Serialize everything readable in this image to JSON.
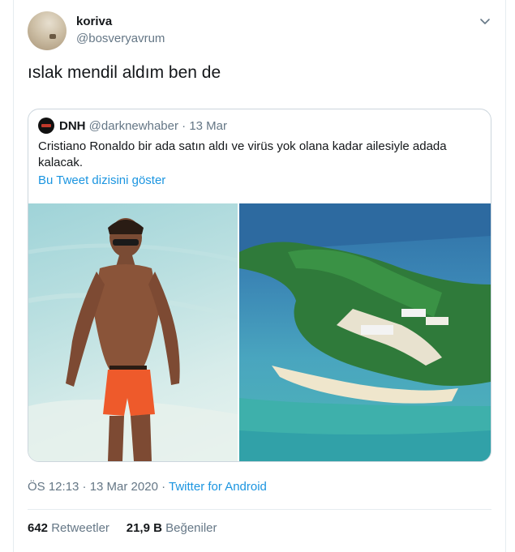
{
  "tweet": {
    "user_name": "koriva",
    "user_handle": "@bosveryavrum",
    "text": "ıslak mendil aldım ben de",
    "timestamp": "ÖS 12:13 · 13 Mar 2020",
    "source_sep": "·",
    "source": "Twitter for Android",
    "retweets_count": "642",
    "retweets_label": "Retweetler",
    "likes_count": "21,9 B",
    "likes_label": "Beğeniler"
  },
  "quote": {
    "name": "DNH",
    "handle": "@darknewhaber",
    "sep": "·",
    "date": "13 Mar",
    "text": "Cristiano Ronaldo bir ada satın aldı ve virüs yok olana kadar ailesiyle adada kalacak.",
    "show_thread": "Bu Tweet dizisini göster"
  },
  "icons": {
    "more": "chevron-down-icon"
  },
  "colors": {
    "link_blue": "#1b95e0",
    "secondary_text": "#657786",
    "border": "#e6ecf0"
  }
}
